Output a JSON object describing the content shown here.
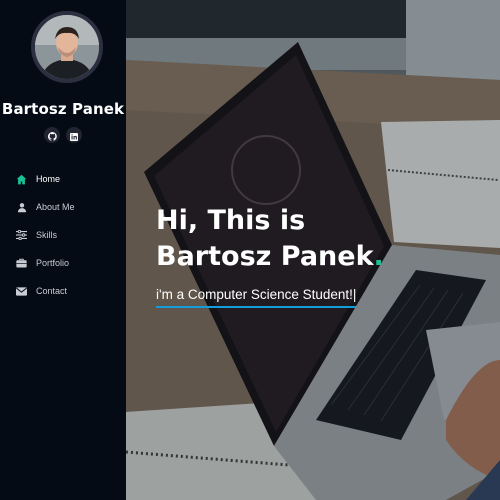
{
  "profile": {
    "name": "Bartosz Panek",
    "socials": [
      {
        "icon": "github-icon"
      },
      {
        "icon": "linkedin-icon"
      }
    ]
  },
  "nav": {
    "items": [
      {
        "label": "Home",
        "icon": "home-icon",
        "active": true
      },
      {
        "label": "About Me",
        "icon": "user-icon",
        "active": false
      },
      {
        "label": "Skills",
        "icon": "sliders-icon",
        "active": false
      },
      {
        "label": "Portfolio",
        "icon": "briefcase-icon",
        "active": false
      },
      {
        "label": "Contact",
        "icon": "envelope-icon",
        "active": false
      }
    ]
  },
  "hero": {
    "line1": "Hi, This is",
    "line2": "Bartosz Panek",
    "dot": ".",
    "subtitle": "i'm a Computer Science Student!|"
  },
  "colors": {
    "sidebar_bg": "#040b14",
    "accent": "#1dbf94",
    "underline": "#149ddd"
  }
}
